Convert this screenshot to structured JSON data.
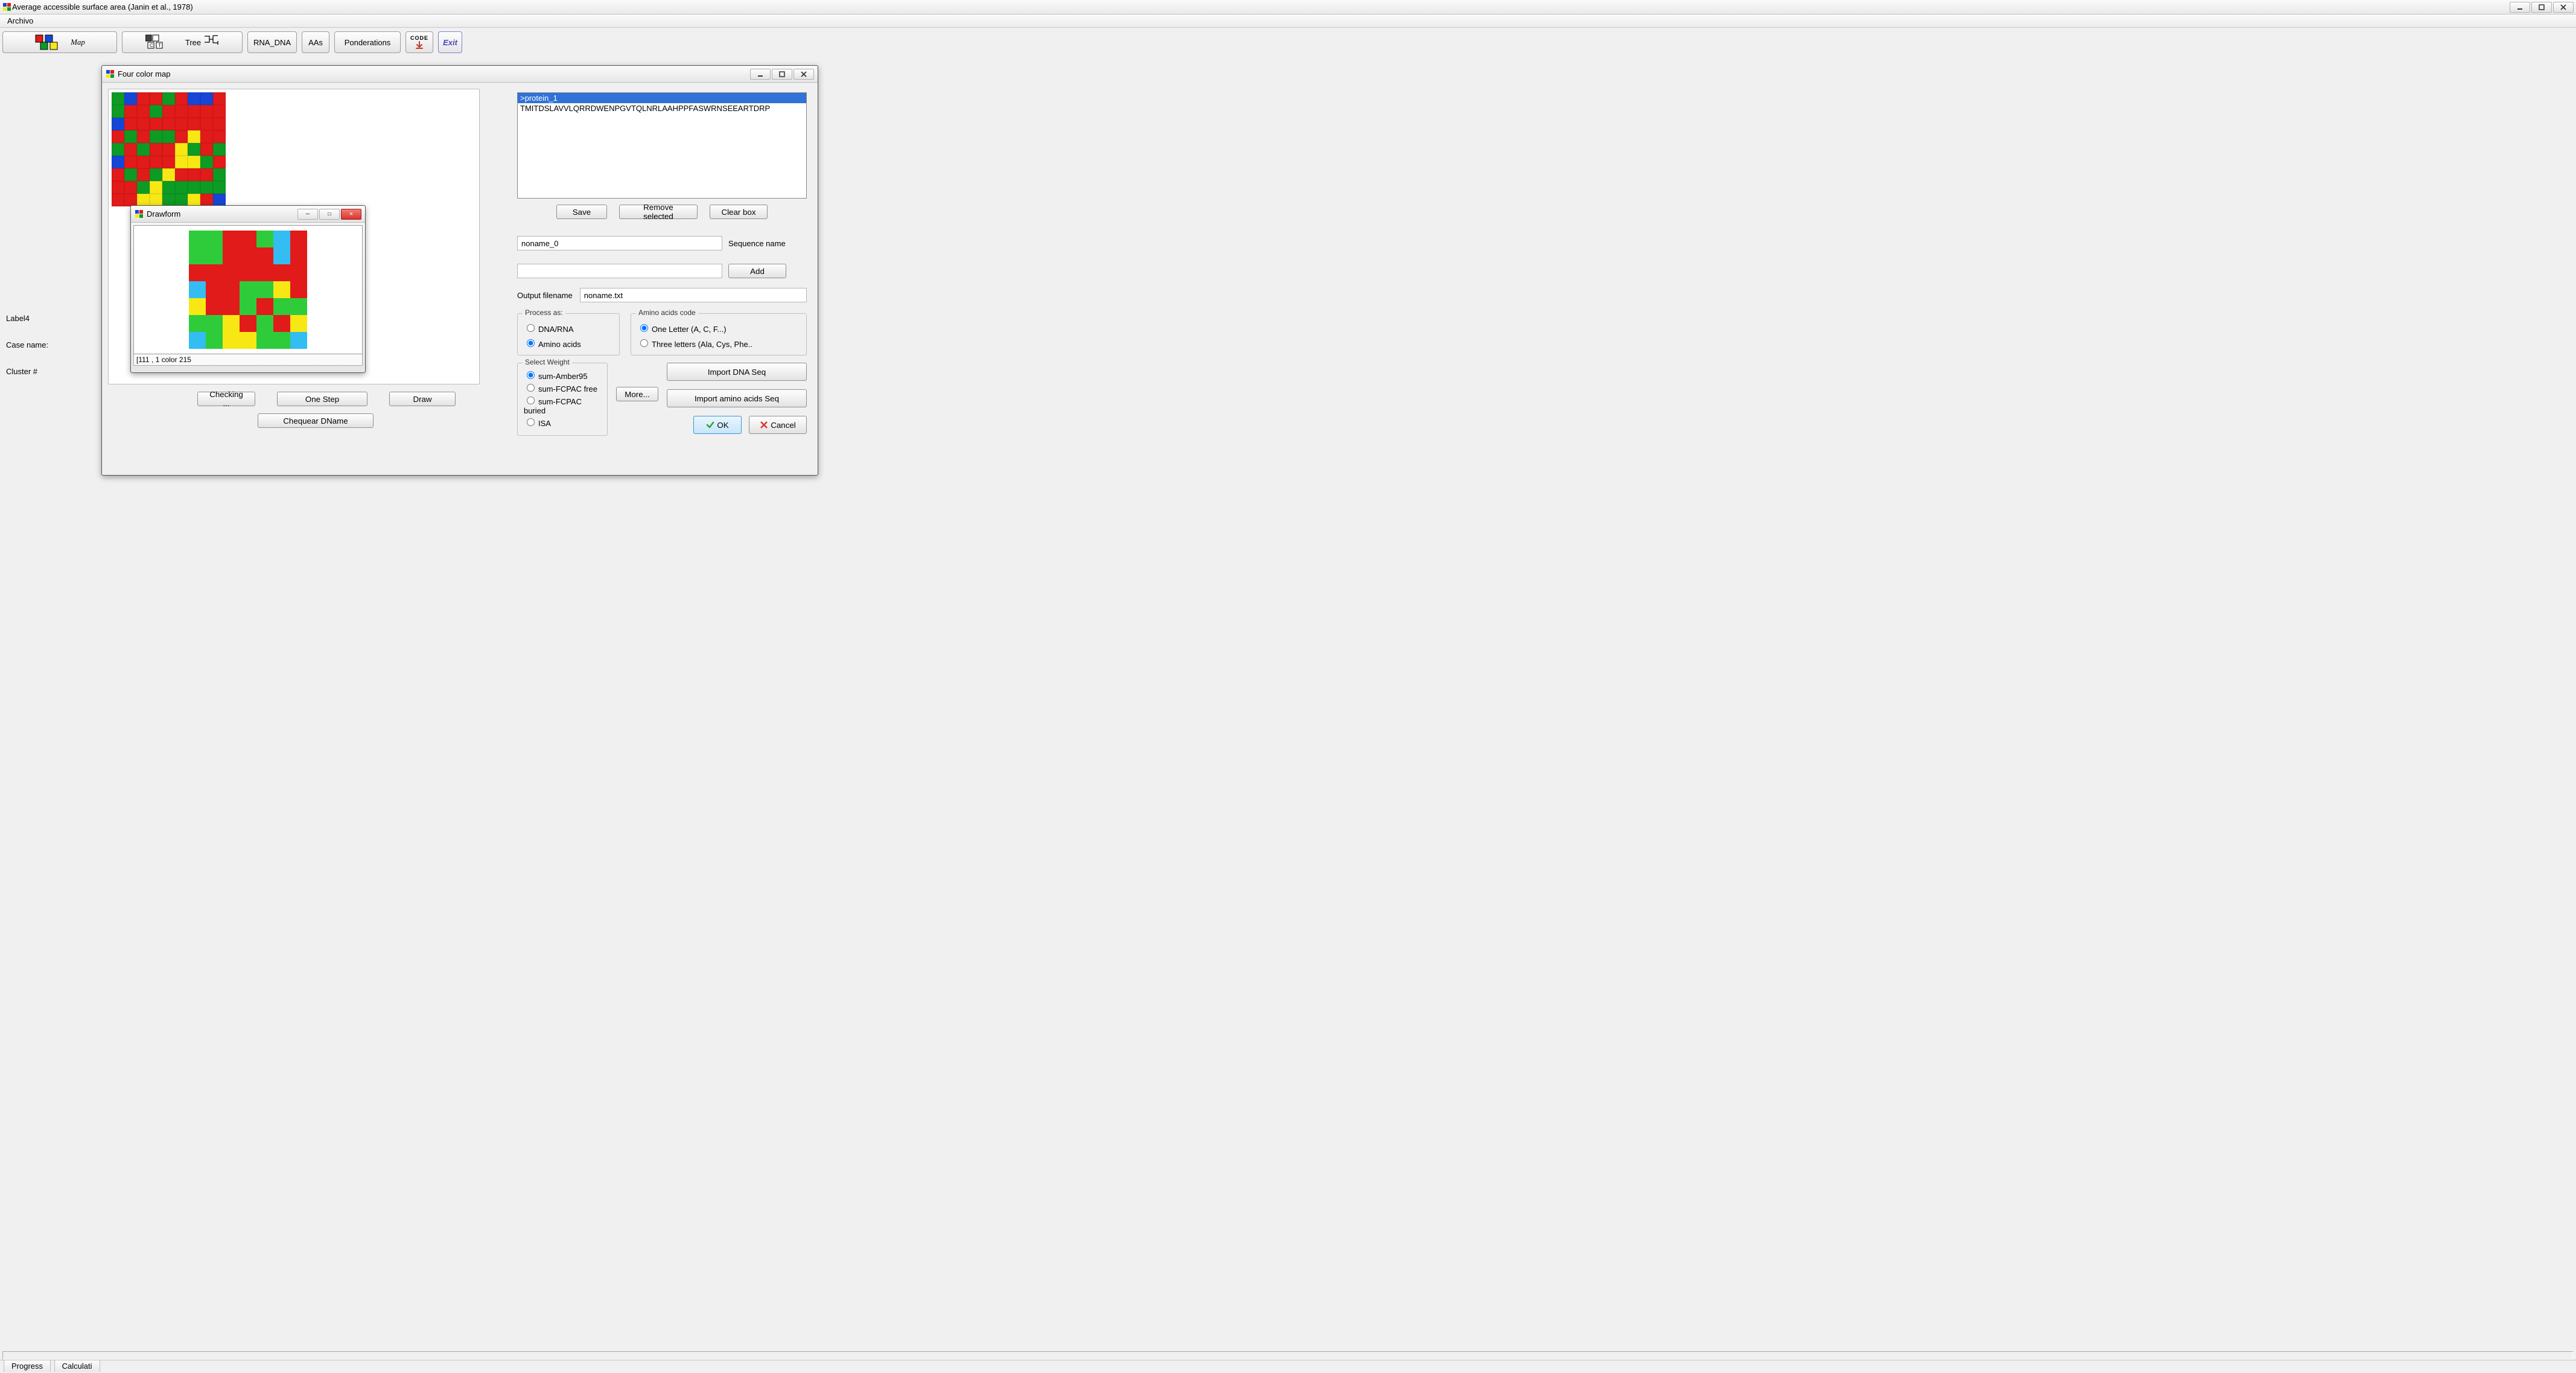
{
  "main_window": {
    "title": "Average accessible surface area (Janin et al., 1978)",
    "blurred_suffix": "                                                                                                                  "
  },
  "menu": {
    "file": "Archivo"
  },
  "toolbar": {
    "map_label": "Map",
    "tree_label": "Tree",
    "rna_dna": "RNA_DNA",
    "aas": "AAs",
    "ponderations": "Ponderations",
    "code": "CODE",
    "exit": "Exit"
  },
  "left_labels": {
    "label4": "Label4",
    "case_name": "Case name:",
    "cluster": "Cluster #"
  },
  "four_color": {
    "title": "Four color map",
    "buttons": {
      "checking": "Checking ...",
      "one_step": "One Step",
      "draw": "Draw",
      "chequear": "Chequear DName"
    },
    "right_panel": {
      "seq_header": ">protein_1",
      "seq_body": "TMITDSLAVVLQRRDWENPGVTQLNRLAAHPPFASWRNSEEARTDRP",
      "save": "Save",
      "remove": "Remove selected",
      "clear": "Clear box",
      "seq_name_value": "noname_0",
      "seq_name_label": "Sequence name",
      "add": "Add",
      "output_label": "Output filename",
      "output_value": "noname.txt",
      "process_as": {
        "legend": "Process as:",
        "dna": "DNA/RNA",
        "aa": "Amino acids"
      },
      "aa_code": {
        "legend": "Amino acids code",
        "one": "One Letter (A, C, F...)",
        "three": "Three letters (Ala, Cys, Phe.."
      },
      "weight": {
        "legend": "Select Weight",
        "amber": "sum-Amber95",
        "fcpac_free": "sum-FCPAC free",
        "fcpac_buried": "sum-FCPAC buried",
        "isa": "ISA"
      },
      "more": "More...",
      "import_dna": "Import DNA Seq",
      "import_aa": "Import amino acids Seq",
      "ok": "OK",
      "cancel": "Cancel"
    }
  },
  "drawform": {
    "title": "Drawform",
    "status": "[111 , 1 color 215"
  },
  "footer": {
    "progress": "Progress",
    "calc": "Calculati"
  },
  "chart_data": {
    "type": "table",
    "note": "9x9 four-color map; letters r,g,b,y = red,green,blue,yellow",
    "main_map": [
      [
        "g",
        "b",
        "r",
        "r",
        "g",
        "r",
        "b",
        "b",
        "r"
      ],
      [
        "g",
        "r",
        "r",
        "g",
        "r",
        "r",
        "r",
        "r",
        "r"
      ],
      [
        "b",
        "r",
        "r",
        "r",
        "r",
        "r",
        "r",
        "r",
        "r"
      ],
      [
        "r",
        "g",
        "r",
        "g",
        "g",
        "r",
        "y",
        "r",
        "r"
      ],
      [
        "g",
        "r",
        "g",
        "r",
        "r",
        "y",
        "g",
        "r",
        "g"
      ],
      [
        "b",
        "r",
        "r",
        "r",
        "r",
        "y",
        "y",
        "g",
        "r"
      ],
      [
        "r",
        "g",
        "r",
        "g",
        "y",
        "r",
        "r",
        "r",
        "g"
      ],
      [
        "r",
        "r",
        "g",
        "y",
        "g",
        "g",
        "g",
        "g",
        "g"
      ],
      [
        "r",
        "r",
        "y",
        "y",
        "g",
        "g",
        "y",
        "r",
        "b"
      ]
    ],
    "drawform_map_7x7_letters_r_g_b_y": [
      [
        "g",
        "g",
        "r",
        "r",
        "g",
        "b",
        "r"
      ],
      [
        "g",
        "g",
        "r",
        "r",
        "r",
        "b",
        "r"
      ],
      [
        "r",
        "r",
        "r",
        "r",
        "r",
        "r",
        "r"
      ],
      [
        "b",
        "r",
        "r",
        "g",
        "g",
        "y",
        "r"
      ],
      [
        "y",
        "r",
        "r",
        "g",
        "r",
        "g",
        "g"
      ],
      [
        "g",
        "g",
        "y",
        "r",
        "g",
        "r",
        "y"
      ],
      [
        "b",
        "g",
        "y",
        "y",
        "g",
        "g",
        "b"
      ]
    ]
  }
}
